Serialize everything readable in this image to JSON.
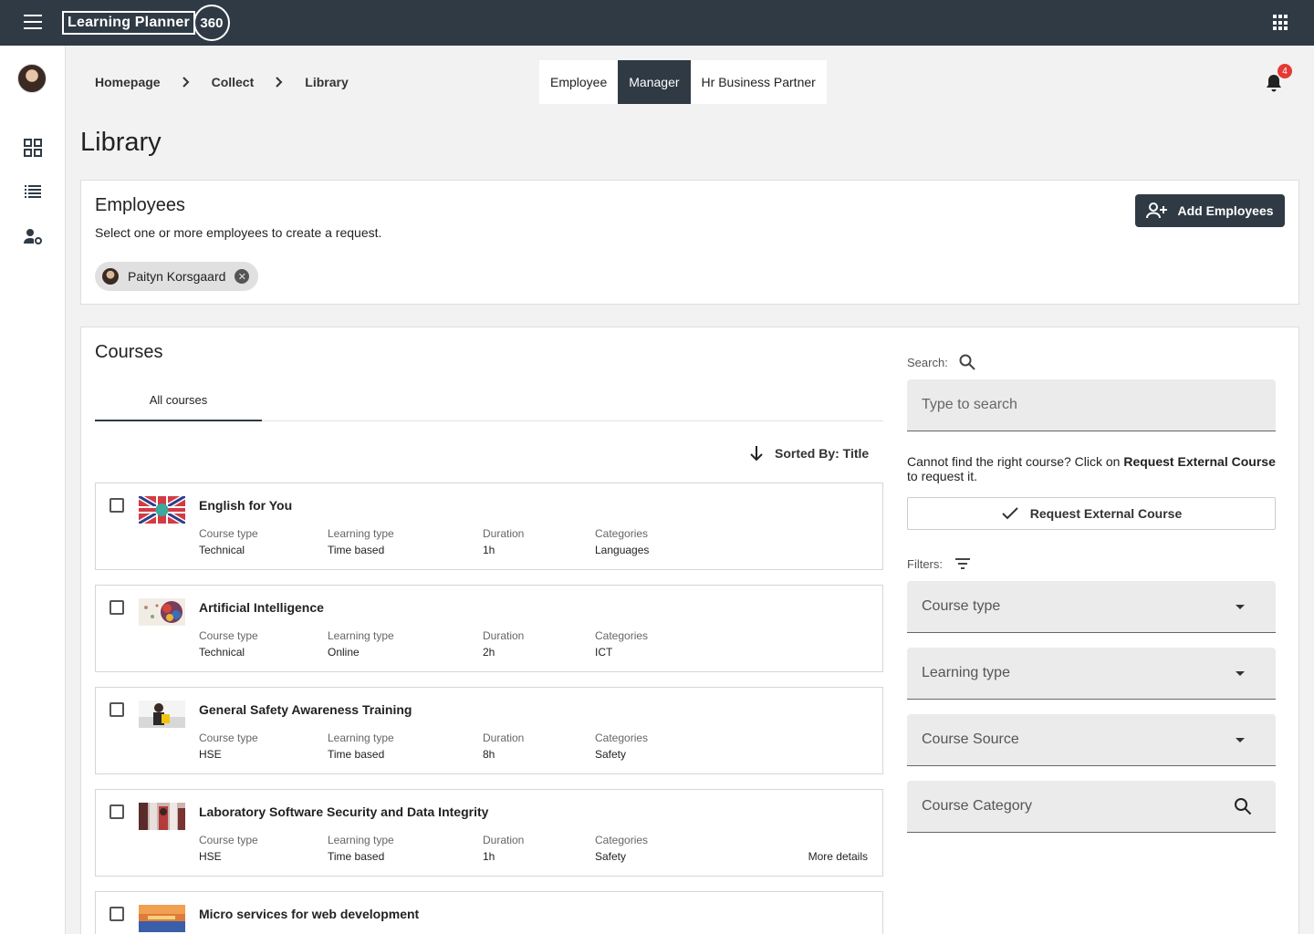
{
  "app": {
    "logo_text": "Learning Planner",
    "logo_number": "360"
  },
  "breadcrumb": [
    "Homepage",
    "Collect",
    "Library"
  ],
  "roles": [
    {
      "label": "Employee",
      "active": false
    },
    {
      "label": "Manager",
      "active": true
    },
    {
      "label": "Hr Business Partner",
      "active": false
    }
  ],
  "notifications": {
    "count": "4"
  },
  "page_title": "Library",
  "employees": {
    "title": "Employees",
    "subtitle": "Select one or more employees to create a request.",
    "add_button": "Add Employees",
    "selected": [
      "Paityn Korsgaard"
    ]
  },
  "courses": {
    "title": "Courses",
    "tabs": [
      "All courses"
    ],
    "sort_label": "Sorted By: Title",
    "labels": {
      "course_type": "Course type",
      "learning_type": "Learning type",
      "duration": "Duration",
      "categories": "Categories"
    },
    "more_details": "More details",
    "items": [
      {
        "title": "English for You",
        "course_type": "Technical",
        "learning_type": "Time based",
        "duration": "1h",
        "categories": "Languages"
      },
      {
        "title": "Artificial Intelligence",
        "course_type": "Technical",
        "learning_type": "Online",
        "duration": "2h",
        "categories": "ICT"
      },
      {
        "title": "General Safety Awareness Training",
        "course_type": "HSE",
        "learning_type": "Time based",
        "duration": "8h",
        "categories": "Safety"
      },
      {
        "title": "Laboratory Software Security and Data Integrity",
        "course_type": "HSE",
        "learning_type": "Time based",
        "duration": "1h",
        "categories": "Safety"
      },
      {
        "title": "Micro services for web development"
      }
    ]
  },
  "search": {
    "label": "Search:",
    "placeholder": "Type to search"
  },
  "help": {
    "text_before": "Cannot find the right course? Click on ",
    "bold": "Request External Course",
    "text_after": " to request it.",
    "button": "Request External Course"
  },
  "filters": {
    "label": "Filters:",
    "course_type": "Course type",
    "learning_type": "Learning type",
    "course_source": "Course Source",
    "course_category": "Course Category"
  },
  "colors": {
    "primary": "#2f3a44",
    "badge": "#e53935"
  }
}
